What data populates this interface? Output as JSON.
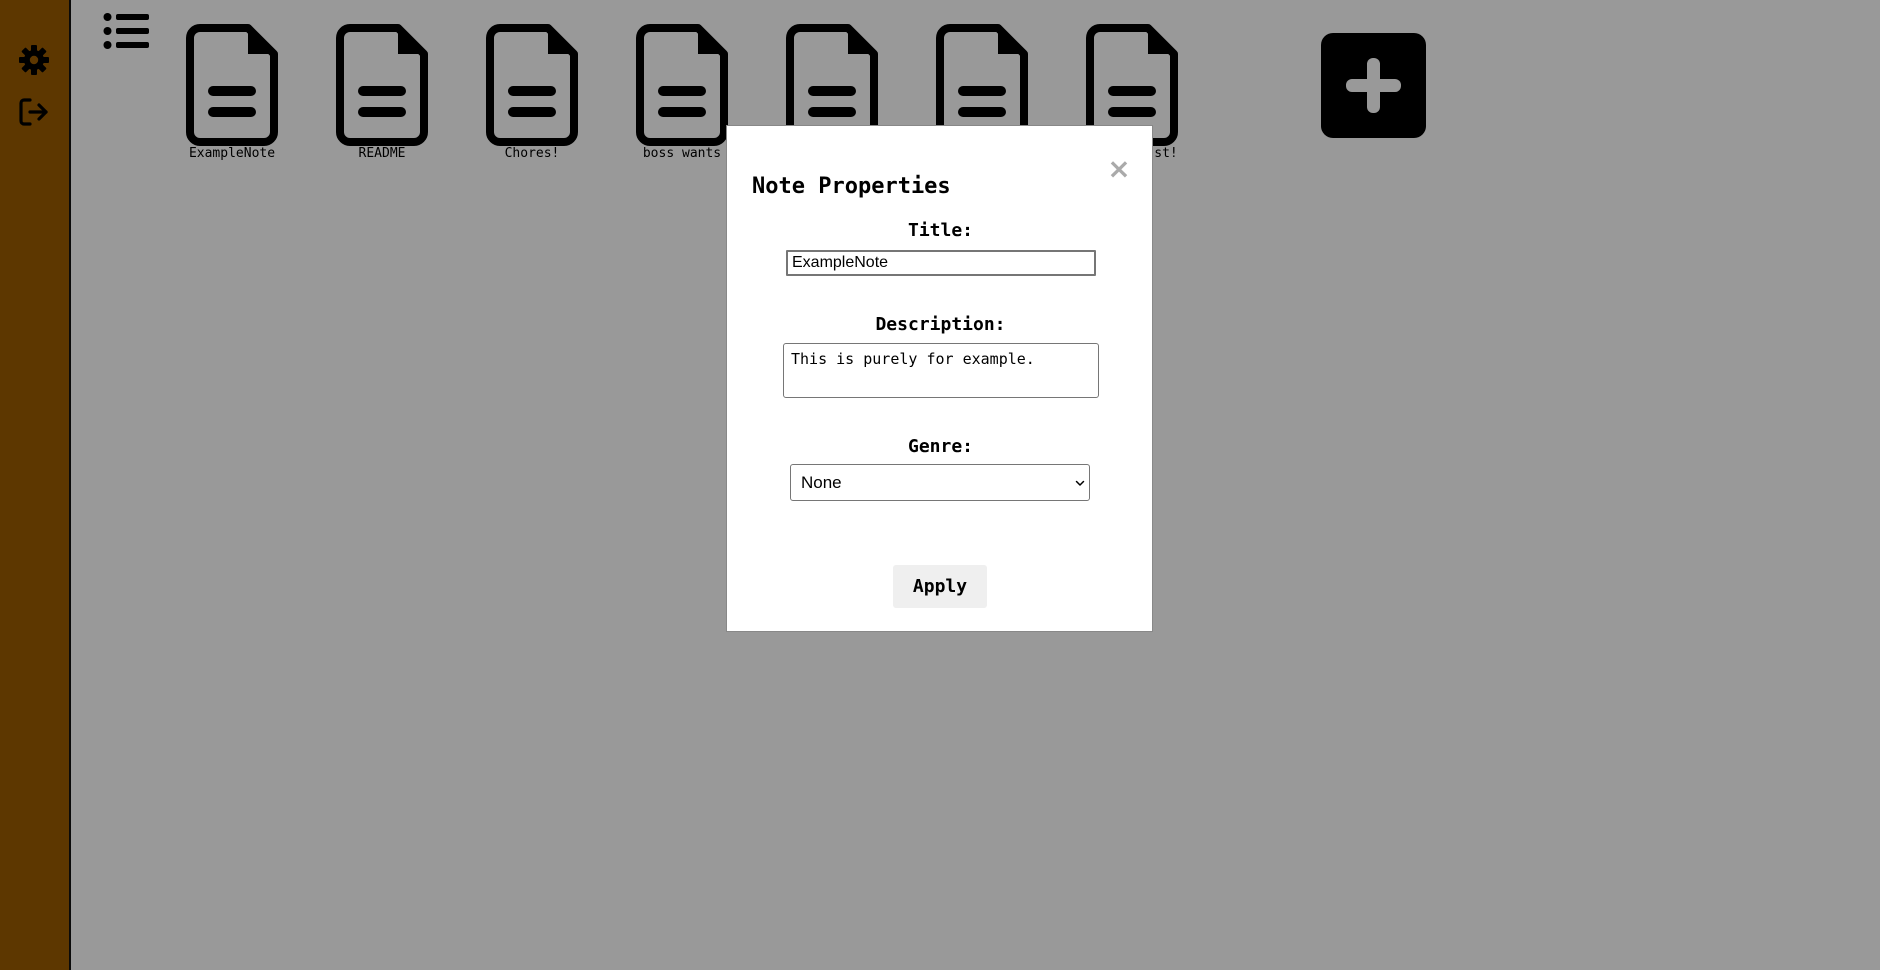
{
  "sidebar": {
    "icons": [
      {
        "name": "gear-icon"
      },
      {
        "name": "logout-icon"
      }
    ],
    "color": "#9b5c00"
  },
  "toolbar": {
    "list_icon": "list-icon"
  },
  "notes": [
    {
      "label": "ExampleNote"
    },
    {
      "label": "README"
    },
    {
      "label": "Chores!"
    },
    {
      "label": "boss wants"
    },
    {
      "label": ""
    },
    {
      "label": ""
    },
    {
      "label": "st!"
    }
  ],
  "add_note": {
    "icon": "plus-icon"
  },
  "modal": {
    "title": "Note Properties",
    "close_label": "×",
    "title_label": "Title:",
    "title_value": "ExampleNote",
    "description_label": "Description:",
    "description_value": "This is purely for example.",
    "genre_label": "Genre:",
    "genre_value": "None",
    "apply_label": "Apply"
  }
}
